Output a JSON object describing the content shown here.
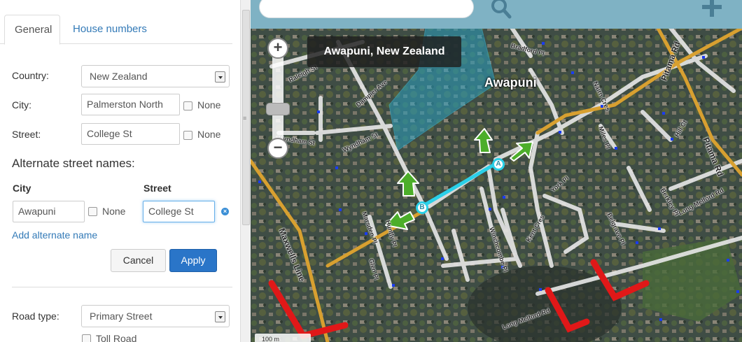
{
  "tabs": {
    "general": "General",
    "house_numbers": "House numbers"
  },
  "form": {
    "country_label": "Country:",
    "country_value": "New Zealand",
    "city_label": "City:",
    "city_value": "Palmerston North",
    "street_label": "Street:",
    "street_value": "College St",
    "none_label": "None",
    "alt_heading": "Alternate street names:",
    "alt_city_header": "City",
    "alt_street_header": "Street",
    "alt_city_value": "Awapuni",
    "alt_street_value": "College St",
    "add_alt": "Add alternate name",
    "cancel": "Cancel",
    "apply": "Apply",
    "road_type_label": "Road type:",
    "road_type_value": "Primary Street",
    "toll_road": "Toll Road"
  },
  "map": {
    "tooltip": "Awapuni, New Zealand",
    "area_label": "Awapuni",
    "node_a": "A",
    "node_b": "B",
    "scale": "100 m",
    "streets": {
      "raleigh": "Raleigh St",
      "dampier": "Dampier Ave",
      "wyndham": "Wyndham St",
      "wyndham2": "Wyndham St",
      "bradford": "Bradford Pl",
      "nairn": "Nairn Cres",
      "miles": "Miles Pl",
      "ptama": "Pitama Rd",
      "ptama2": "Pitama Rd",
      "hill": "Hill Ct",
      "york": "York Pl",
      "berkley": "Berkley Pl",
      "belgrave": "Belgrave Pl",
      "longmelford": "Long Melford Rd",
      "longmelford2": "Long Melford Rd",
      "maxwells": "Maxwells Line",
      "marsden": "Marsden Pl",
      "winchcombe": "Winchcombe Pl",
      "kent": "Kent Cres",
      "glen": "Glen Pl",
      "huntly": "Huntly Pl"
    }
  },
  "colors": {
    "link": "#337ab7",
    "apply_button": "#2a75c8",
    "segment_selected": "#2ad0e8",
    "primary_road": "#d8a030",
    "highlight_red": "#e01818",
    "arrow_green": "#4cae2a"
  }
}
